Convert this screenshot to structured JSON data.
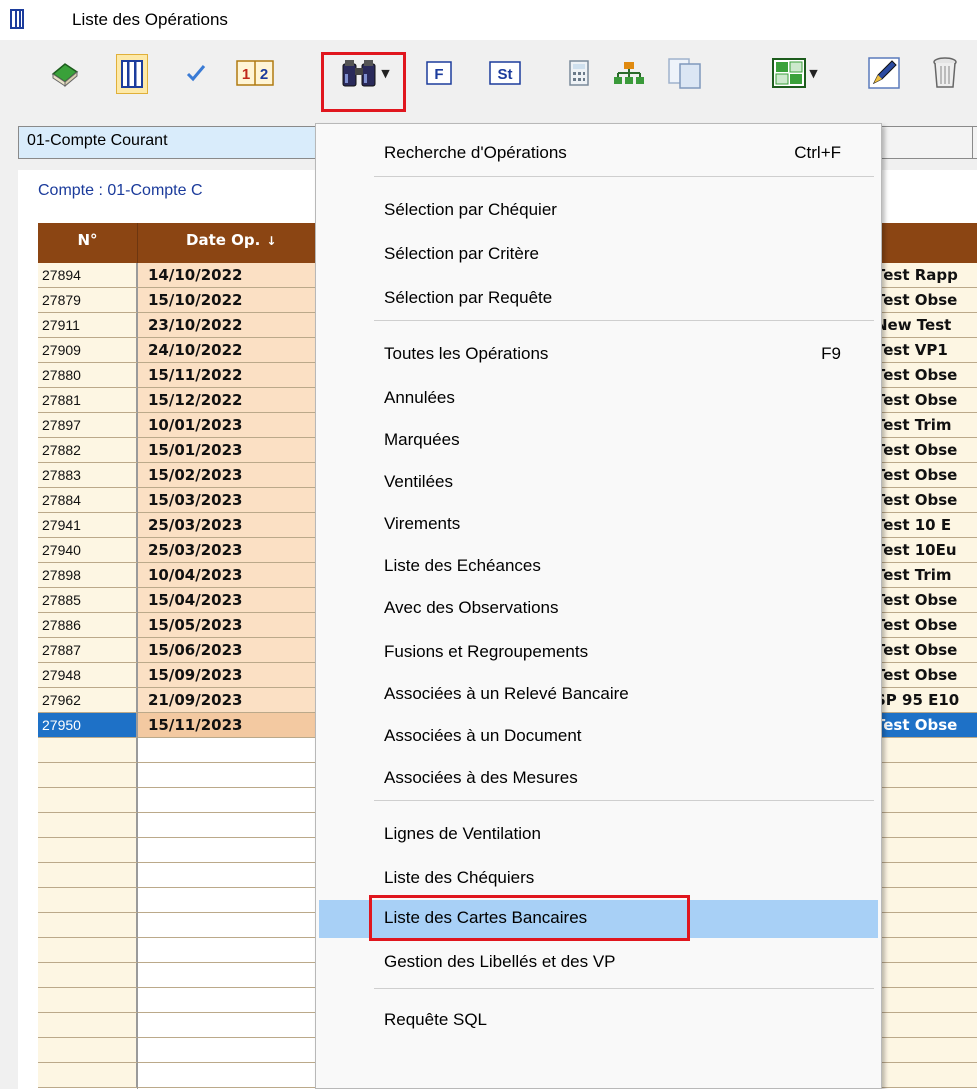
{
  "window": {
    "title": "Liste des Opérations"
  },
  "toolbar": {
    "buttons": [
      {
        "icon": "book-icon"
      },
      {
        "icon": "columns-icon"
      },
      {
        "icon": "checkmark-icon"
      },
      {
        "icon": "number-1-2-icon",
        "text": "1|2"
      },
      {
        "icon": "binoculars-icon"
      },
      {
        "icon": "f-icon",
        "text": "F"
      },
      {
        "icon": "st-icon",
        "text": "St"
      },
      {
        "icon": "calculator-icon"
      },
      {
        "icon": "org-chart-icon"
      },
      {
        "icon": "copy-icon"
      },
      {
        "icon": "grid-view-icon"
      },
      {
        "icon": "pen-icon"
      },
      {
        "icon": "trash-icon"
      }
    ]
  },
  "account": {
    "selected": "01-Compte Courant",
    "panel_label": "Compte : 01-Compte C"
  },
  "grid": {
    "headers": {
      "no": "N°",
      "date": "Date Op."
    },
    "rows": [
      {
        "no": "27894",
        "date": "14/10/2022",
        "desc": "Test Rapp"
      },
      {
        "no": "27879",
        "date": "15/10/2022",
        "desc": "Test Obse"
      },
      {
        "no": "27911",
        "date": "23/10/2022",
        "desc": "New Test"
      },
      {
        "no": "27909",
        "date": "24/10/2022",
        "desc": "Test VP1"
      },
      {
        "no": "27880",
        "date": "15/11/2022",
        "desc": "Test Obse"
      },
      {
        "no": "27881",
        "date": "15/12/2022",
        "desc": "Test Obse"
      },
      {
        "no": "27897",
        "date": "10/01/2023",
        "desc": "Test Trim"
      },
      {
        "no": "27882",
        "date": "15/01/2023",
        "desc": "Test Obse"
      },
      {
        "no": "27883",
        "date": "15/02/2023",
        "desc": "Test Obse"
      },
      {
        "no": "27884",
        "date": "15/03/2023",
        "desc": "Test Obse"
      },
      {
        "no": "27941",
        "date": "25/03/2023",
        "desc": "Test 10 E"
      },
      {
        "no": "27940",
        "date": "25/03/2023",
        "desc": "Test 10Eu"
      },
      {
        "no": "27898",
        "date": "10/04/2023",
        "desc": "Test Trim"
      },
      {
        "no": "27885",
        "date": "15/04/2023",
        "desc": "Test Obse"
      },
      {
        "no": "27886",
        "date": "15/05/2023",
        "desc": "Test Obse"
      },
      {
        "no": "27887",
        "date": "15/06/2023",
        "desc": "Test Obse"
      },
      {
        "no": "27948",
        "date": "15/09/2023",
        "desc": "Test Obse"
      },
      {
        "no": "27962",
        "date": "21/09/2023",
        "desc": "SP 95 E10"
      },
      {
        "no": "27950",
        "date": "15/11/2023",
        "desc": "Test Obse",
        "selected": true
      }
    ]
  },
  "menu": {
    "items": [
      {
        "label": "Recherche d'Opérations",
        "shortcut": "Ctrl+F"
      },
      {
        "label": "Sélection par Chéquier"
      },
      {
        "label": "Sélection par Critère"
      },
      {
        "label": "Sélection par Requête"
      },
      {
        "label": "Toutes les Opérations",
        "shortcut": "F9"
      },
      {
        "label": "Annulées"
      },
      {
        "label": "Marquées"
      },
      {
        "label": "Ventilées"
      },
      {
        "label": "Virements"
      },
      {
        "label": "Liste des Echéances"
      },
      {
        "label": "Avec des Observations"
      },
      {
        "label": "Fusions et Regroupements"
      },
      {
        "label": "Associées à un Relevé Bancaire"
      },
      {
        "label": "Associées à un Document"
      },
      {
        "label": "Associées à des Mesures"
      },
      {
        "label": "Lignes de Ventilation"
      },
      {
        "label": "Liste des Chéquiers"
      },
      {
        "label": "Liste des Cartes Bancaires",
        "highlighted": true
      },
      {
        "label": "Gestion des Libellés et des VP"
      },
      {
        "label": "Requête SQL"
      }
    ]
  },
  "colors": {
    "header_bg": "#8b4513",
    "selection": "#1e71c7",
    "highlight": "#a8d0f6",
    "marker": "#e0161e"
  }
}
